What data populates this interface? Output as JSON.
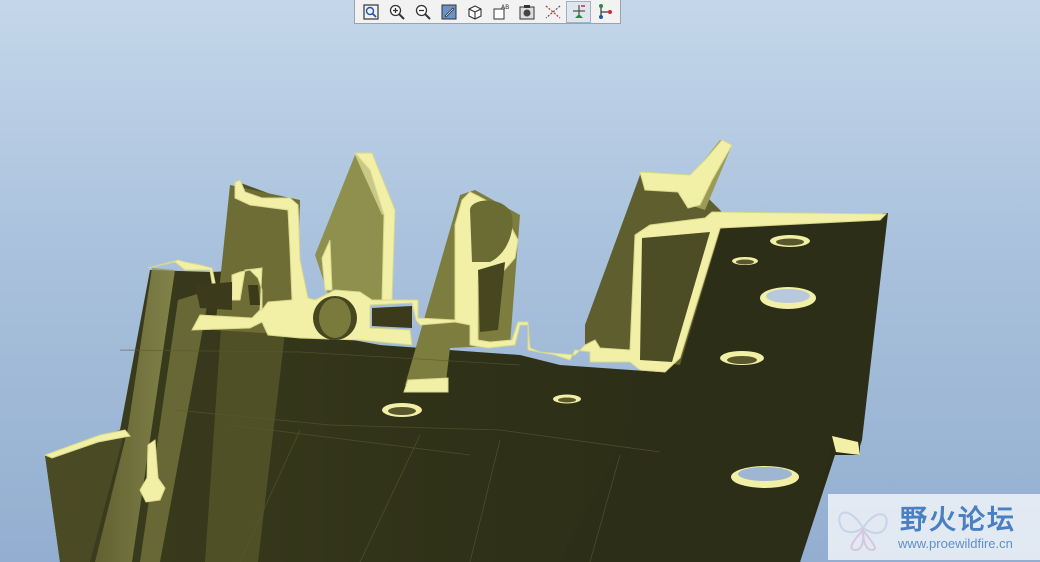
{
  "toolbar": {
    "buttons": [
      {
        "icon": "refit-icon"
      },
      {
        "icon": "zoom-in-icon"
      },
      {
        "icon": "zoom-out-icon"
      },
      {
        "icon": "repaint-icon"
      },
      {
        "icon": "named-view-icon"
      },
      {
        "icon": "saved-views-icon"
      },
      {
        "icon": "model-display-icon"
      },
      {
        "icon": "datum-axes-icon"
      },
      {
        "icon": "datum-points-icon",
        "active": true
      },
      {
        "icon": "csys-display-icon"
      }
    ]
  },
  "colors": {
    "background_top": "#c4d7ea",
    "background_bottom": "#93aed0",
    "section_face": "#f1f0a6",
    "body_dark": "#2f3118",
    "body_mid": "#58582c",
    "body_light": "#8c8c4d"
  },
  "watermark": {
    "title": "野火论坛",
    "url": "www.proewildfire.cn"
  }
}
